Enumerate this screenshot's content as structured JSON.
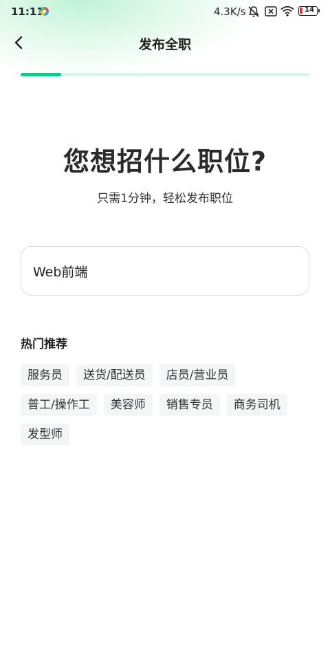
{
  "status_bar": {
    "time": "11:11",
    "network_speed": "4.3K/s",
    "battery_level": "14",
    "icons": [
      "app-notification-icon",
      "mute-bell-icon",
      "sim-x-icon",
      "wifi-icon",
      "battery-icon"
    ]
  },
  "header": {
    "title": "发布全职",
    "back_icon": "chevron-left-icon"
  },
  "progress": {
    "fraction": 0.14
  },
  "hero": {
    "title": "您想招什么职位?",
    "subtitle": "只需1分钟，轻松发布职位"
  },
  "job_input": {
    "value": "Web前端"
  },
  "hot": {
    "title": "热门推荐",
    "tags": [
      "服务员",
      "送货/配送员",
      "店员/营业员",
      "普工/操作工",
      "美容师",
      "销售专员",
      "商务司机",
      "发型师"
    ]
  },
  "colors": {
    "accent": "#13c98a",
    "progress_track": "#d7f7e7",
    "tag_background": "#f4f5f7"
  }
}
